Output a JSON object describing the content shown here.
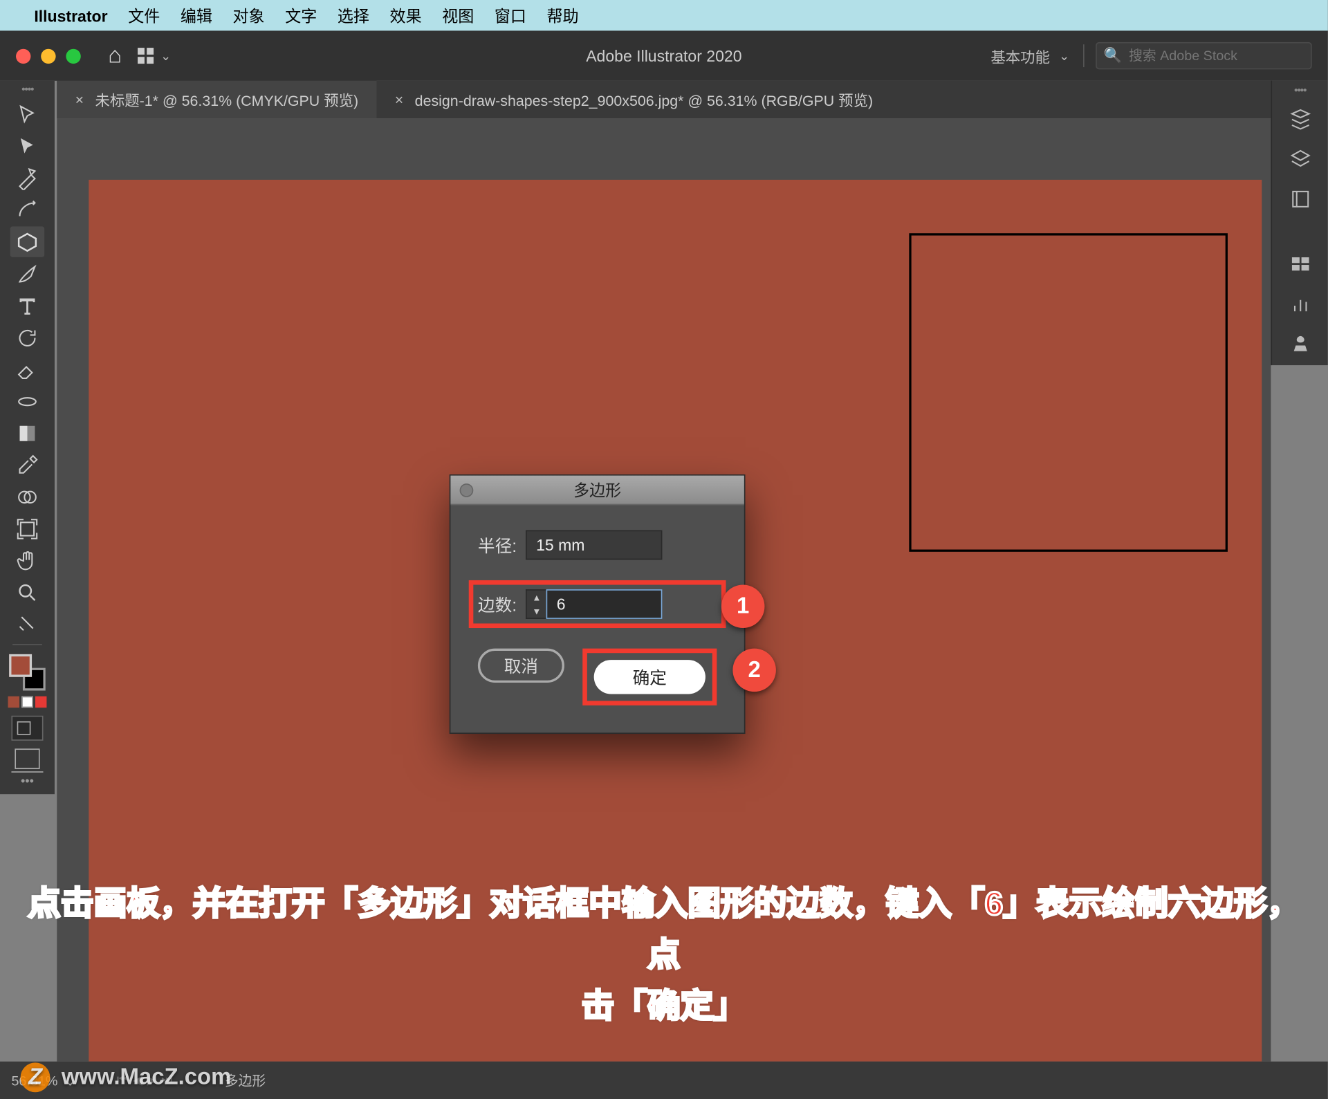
{
  "menubar": {
    "app": "Illustrator",
    "items": [
      "文件",
      "编辑",
      "对象",
      "文字",
      "选择",
      "效果",
      "视图",
      "窗口",
      "帮助"
    ]
  },
  "appbar": {
    "title": "Adobe Illustrator 2020",
    "workspace": "基本功能",
    "search_placeholder": "搜索 Adobe Stock"
  },
  "tabs": [
    {
      "label": "未标题-1* @ 56.31% (CMYK/GPU 预览)",
      "active": true
    },
    {
      "label": "design-draw-shapes-step2_900x506.jpg* @ 56.31% (RGB/GPU 预览)",
      "active": false
    }
  ],
  "dialog": {
    "title": "多边形",
    "radius_label": "半径:",
    "radius_value": "15 mm",
    "sides_label": "边数:",
    "sides_value": "6",
    "cancel": "取消",
    "ok": "确定"
  },
  "callouts": {
    "one": "1",
    "two": "2"
  },
  "status": {
    "zoom": "56.31%",
    "shape": "多边形"
  },
  "instruction_line1": "点击画板，并在打开「多边形」对话框中输入图形的边数，键入「6」表示绘制六边形，点",
  "instruction_line2": "击「确定」",
  "watermark": "www.MacZ.com",
  "colors": {
    "artboard": "#a34c39",
    "accent_red": "#f13a2f"
  }
}
